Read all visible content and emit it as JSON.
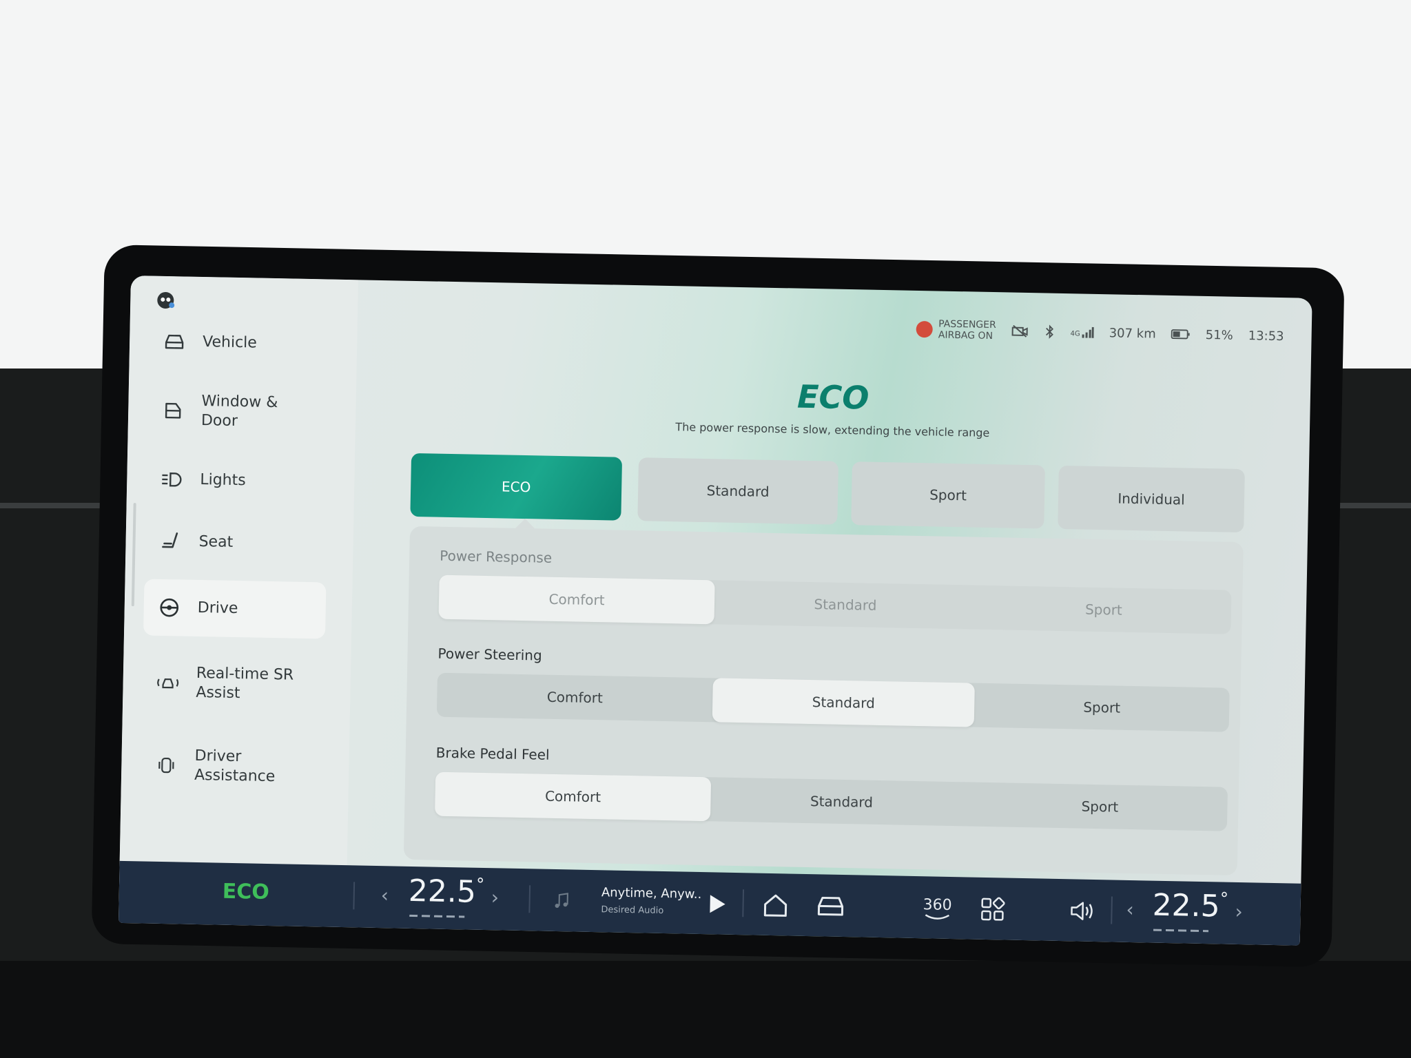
{
  "status_bar": {
    "airbag_line1": "PASSENGER",
    "airbag_line2": "AIRBAG ON",
    "network": "4G",
    "range": "307 km",
    "battery": "51%",
    "time": "13:53"
  },
  "sidebar": {
    "items": [
      {
        "label": "Vehicle",
        "icon": "car-icon"
      },
      {
        "label": "Window & Door",
        "icon": "door-icon"
      },
      {
        "label": "Lights",
        "icon": "headlight-icon"
      },
      {
        "label": "Seat",
        "icon": "seat-icon"
      },
      {
        "label": "Drive",
        "icon": "steering-wheel-icon",
        "active": true
      },
      {
        "label": "Real-time SR Assist",
        "icon": "sr-assist-icon"
      },
      {
        "label": "Driver Assistance",
        "icon": "driver-assist-icon"
      }
    ]
  },
  "drive": {
    "mode_title": "ECO",
    "mode_description": "The power response is slow, extending the vehicle range",
    "tabs": [
      "ECO",
      "Standard",
      "Sport",
      "Individual"
    ],
    "selected_tab": "ECO",
    "sections": [
      {
        "label": "Power Response",
        "options": [
          "Comfort",
          "Standard",
          "Sport"
        ],
        "selected": "Comfort",
        "enabled": false
      },
      {
        "label": "Power Steering",
        "options": [
          "Comfort",
          "Standard",
          "Sport"
        ],
        "selected": "Standard",
        "enabled": true
      },
      {
        "label": "Brake Pedal Feel",
        "options": [
          "Comfort",
          "Standard",
          "Sport"
        ],
        "selected": "Comfort",
        "enabled": true
      }
    ]
  },
  "bottom_bar": {
    "drive_mode": "ECO",
    "left_temp": "22.5",
    "right_temp": "22.5",
    "degree": "°",
    "media_title": "Anytime, Anyw..",
    "media_subtitle": "Desired Audio",
    "camera_label": "360"
  },
  "colors": {
    "accent": "#0b7f6d",
    "eco_green": "#3fbe5a",
    "bar_bg": "#1f2e43"
  }
}
